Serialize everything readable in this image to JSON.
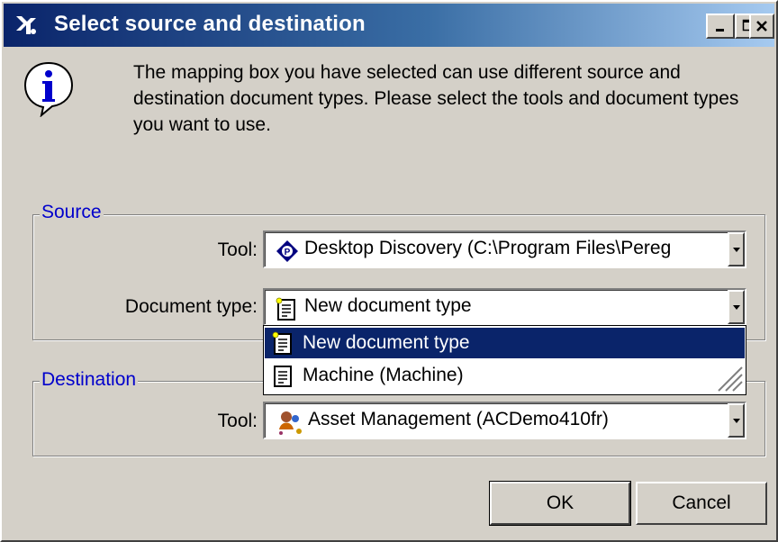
{
  "window": {
    "title": "Select source and destination",
    "controls": [
      "minimize",
      "maximize",
      "close"
    ]
  },
  "message": "The mapping box you have selected can use different source and destination document types. Please select the tools and document types you want to use.",
  "source": {
    "legend": "Source",
    "tool_label": "Tool:",
    "tool_value": "Desktop Discovery (C:\\Program Files\\Pereg",
    "doctype_label": "Document type:",
    "doctype_value": "New document type",
    "dropdown_items": [
      {
        "label": "New document type",
        "selected": true
      },
      {
        "label": "Machine (Machine)",
        "selected": false
      }
    ]
  },
  "destination": {
    "legend": "Destination",
    "tool_label": "Tool:",
    "tool_value": "Asset Management (ACDemo410fr)"
  },
  "buttons": {
    "ok": "OK",
    "cancel": "Cancel"
  },
  "colors": {
    "titlebar_start": "#0a246a",
    "titlebar_end": "#a6caf0",
    "selection": "#0a246a",
    "legend_text": "#0000cc",
    "face": "#d4d0c8"
  }
}
